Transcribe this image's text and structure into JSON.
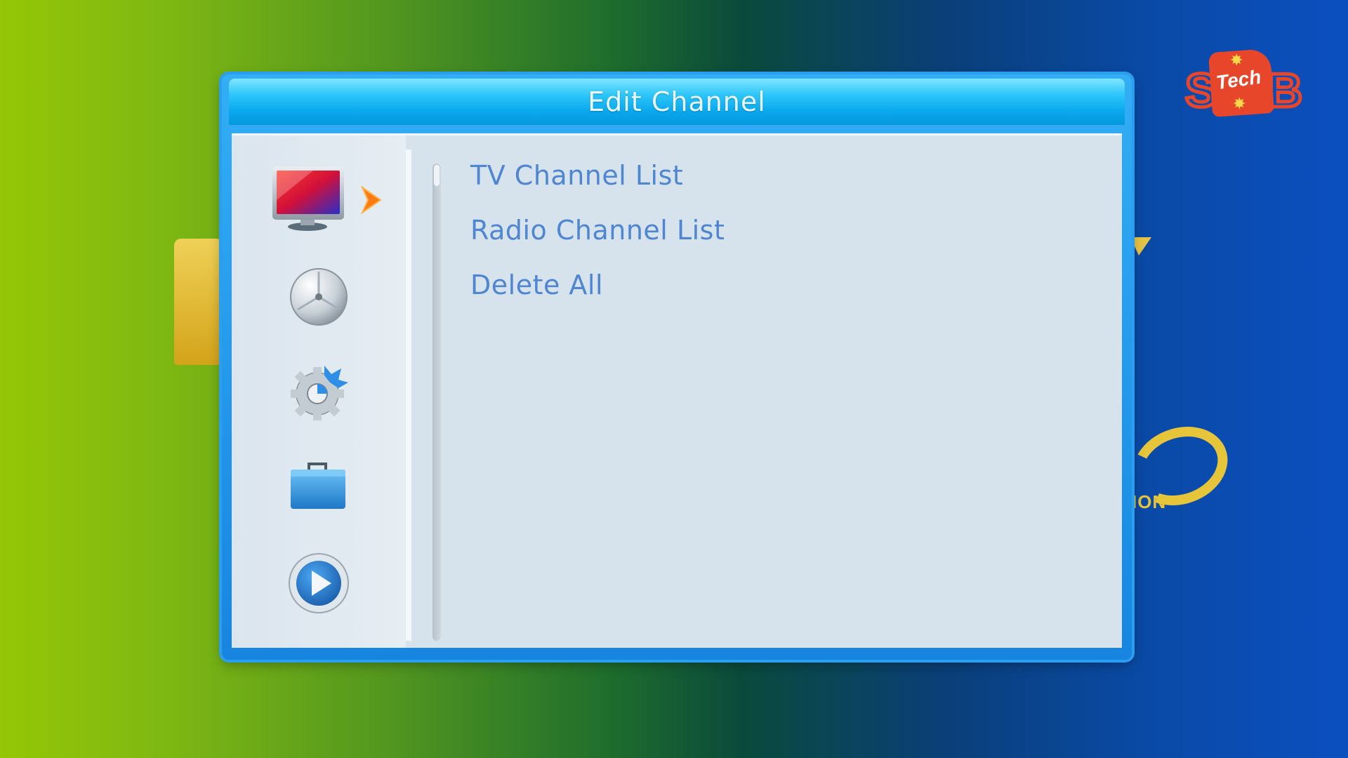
{
  "dialog": {
    "title": "Edit Channel"
  },
  "sidebar": {
    "icons": [
      "tv-icon",
      "satellite-dish-icon",
      "settings-gear-icon",
      "toolbox-icon",
      "media-play-icon"
    ],
    "selected": "tv-icon"
  },
  "menu": {
    "items": [
      {
        "label": "TV Channel List"
      },
      {
        "label": "Radio Channel List"
      },
      {
        "label": "Delete All"
      }
    ]
  },
  "background": {
    "caption": "ION"
  },
  "logo": {
    "left_letter": "S",
    "word": "Tech",
    "right_letter": "B"
  },
  "colors": {
    "title_bar": "#0aa9ee",
    "panel": "#d6e2ec",
    "menu_text": "#4f86d2",
    "selection_arrow": "#ff7a10",
    "logo": "#e8462a"
  }
}
